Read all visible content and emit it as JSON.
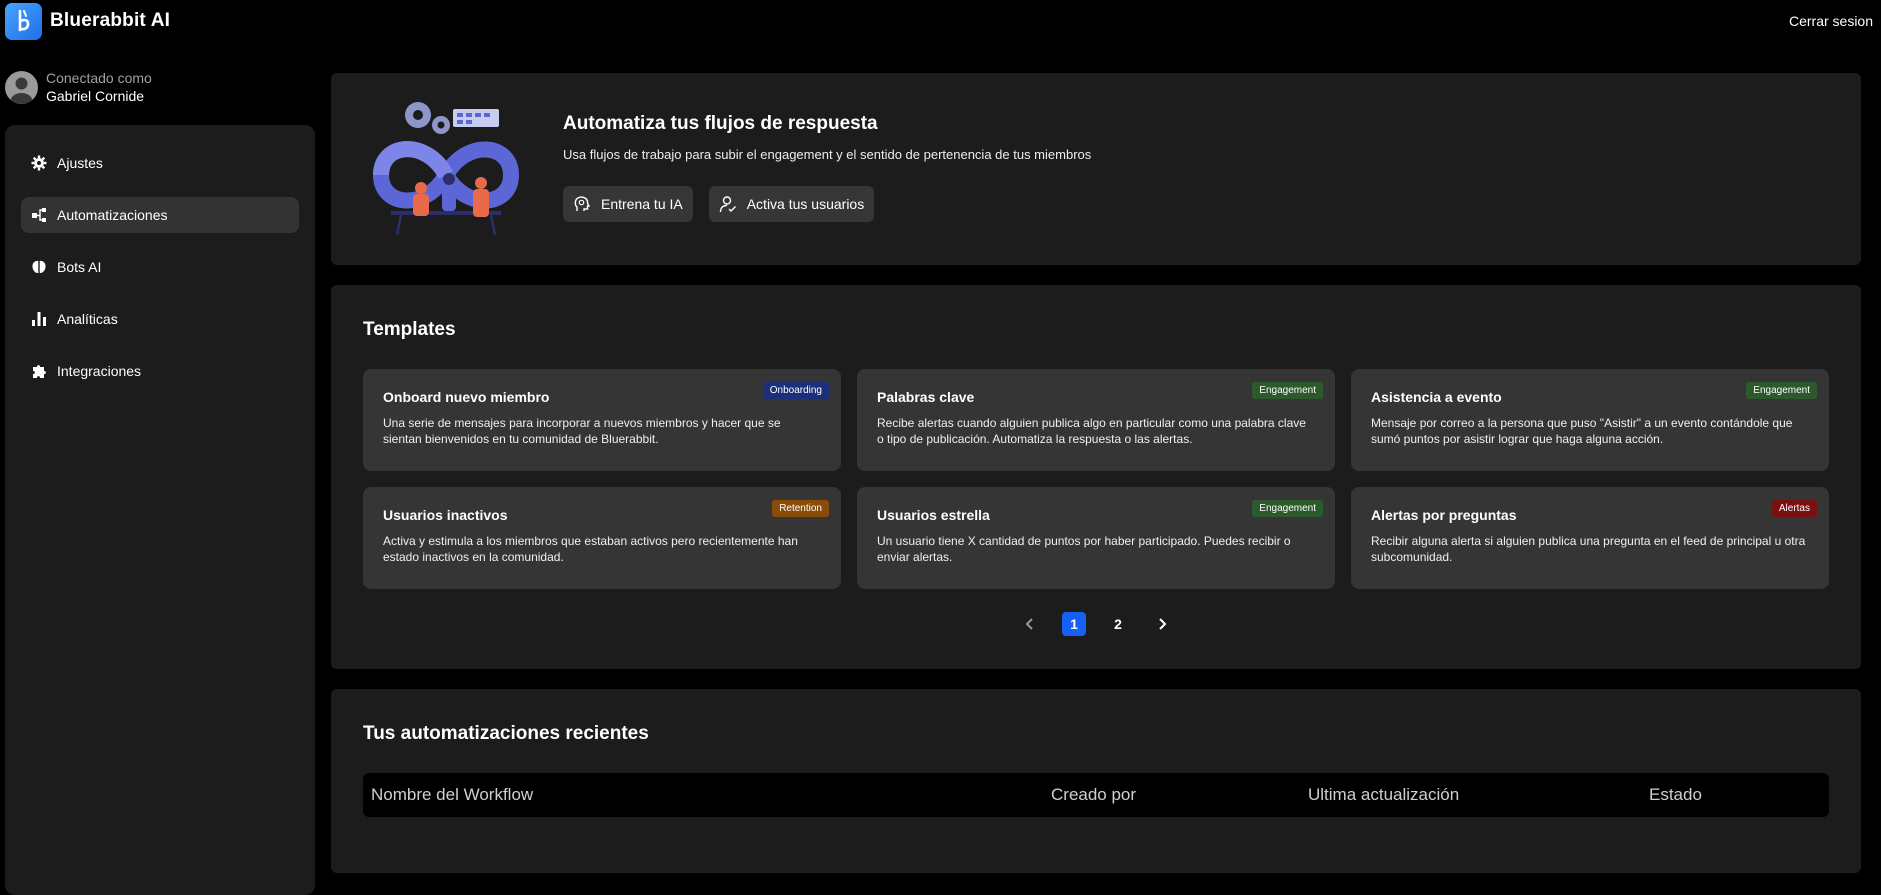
{
  "header": {
    "brand_name": "Bluerabbit AI",
    "logout_label": "Cerrar sesion"
  },
  "user": {
    "connected_label": "Conectado como",
    "name": "Gabriel Cornide"
  },
  "sidebar": {
    "items": [
      {
        "label": "Ajustes",
        "icon": "gear-icon"
      },
      {
        "label": "Automatizaciones",
        "icon": "workflow-icon",
        "active": true
      },
      {
        "label": "Bots AI",
        "icon": "brain-icon"
      },
      {
        "label": "Analíticas",
        "icon": "bar-chart-icon"
      },
      {
        "label": "Integraciones",
        "icon": "puzzle-icon"
      }
    ]
  },
  "hero": {
    "title": "Automatiza tus flujos de respuesta",
    "subtitle": "Usa flujos de trabajo para subir el engagement y el sentido de pertenencia de tus miembros",
    "actions": [
      {
        "label": "Entrena tu IA",
        "icon": "ai-head-icon"
      },
      {
        "label": "Activa tus usuarios",
        "icon": "user-check-icon"
      }
    ]
  },
  "templates": {
    "title": "Templates",
    "cards": [
      {
        "title": "Onboard nuevo miembro",
        "badge": "Onboarding",
        "badge_color": "#1b2f7a",
        "description": "Una serie de mensajes para incorporar a nuevos miembros y hacer que se sientan bienvenidos en tu comunidad de Bluerabbit."
      },
      {
        "title": "Palabras clave",
        "badge": "Engagement",
        "badge_color": "#2c5a2c",
        "description": "Recibe alertas cuando alguien publica algo en particular como una palabra clave o tipo de publicación. Automatiza la respuesta o las alertas."
      },
      {
        "title": "Asistencia a evento",
        "badge": "Engagement",
        "badge_color": "#2c5a2c",
        "description": "Mensaje por correo a la persona que puso \"Asistir\" a un evento contándole que sumó puntos por asistir lograr que haga alguna acción."
      },
      {
        "title": "Usuarios inactivos",
        "badge": "Retention",
        "badge_color": "#8a4d08",
        "description": "Activa y estimula a los miembros que estaban activos pero recientemente han estado inactivos en la comunidad."
      },
      {
        "title": "Usuarios estrella",
        "badge": "Engagement",
        "badge_color": "#2c5a2c",
        "description": "Un usuario tiene X cantidad de puntos por haber participado. Puedes recibir o enviar alertas."
      },
      {
        "title": "Alertas por preguntas",
        "badge": "Alertas",
        "badge_color": "#7a1010",
        "description": "Recibir alguna alerta si alguien publica una pregunta en el feed de principal u otra subcomunidad."
      }
    ],
    "pagination": {
      "pages": [
        "1",
        "2"
      ],
      "current": "1"
    }
  },
  "recent": {
    "title": "Tus automatizaciones recientes",
    "columns": [
      "Nombre del Workflow",
      "Creado por",
      "Ultima actualización",
      "Estado"
    ]
  },
  "colors": {
    "accent": "#1660f5",
    "panel": "#1c1c1c",
    "card": "#353535"
  }
}
